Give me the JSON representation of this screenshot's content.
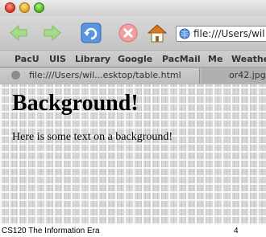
{
  "browser": {
    "address_bar": {
      "url": "file:///Users/wil"
    },
    "bookmarks": [
      "PacU",
      "UIS",
      "Library",
      "Google",
      "PacMail",
      "Me",
      "Weather"
    ],
    "tabs": [
      {
        "label": "file:///Users/wil...esktop/table.html",
        "active": true
      },
      {
        "label": "or42.jpg",
        "active": false
      }
    ]
  },
  "page": {
    "heading": "Background!",
    "paragraph": "Here is some text on a background!"
  },
  "slide": {
    "footer_left": "CS120 The Information Era",
    "page_number": "4"
  },
  "icons": {
    "back": "back-arrow-icon",
    "forward": "forward-arrow-icon",
    "reload": "reload-icon",
    "stop": "stop-icon",
    "home": "home-icon",
    "site": "globe-icon"
  },
  "colors": {
    "nav_arrow": "#7cc05a",
    "reload": "#3a7bd5",
    "stop": "#e06060",
    "home_roof": "#d9761e"
  }
}
